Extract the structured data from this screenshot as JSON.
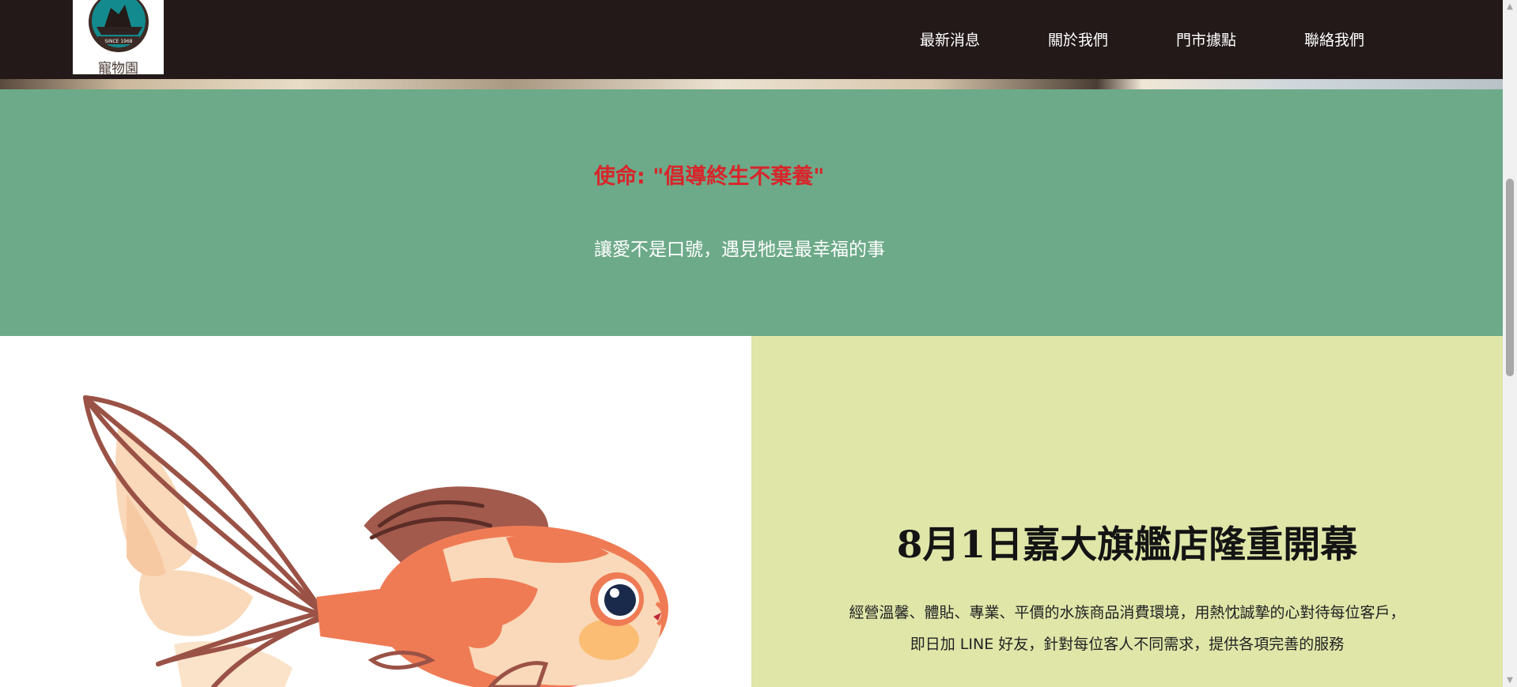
{
  "header": {
    "logo": {
      "name": "寵物園",
      "badge_text": "SINCE 1968"
    },
    "nav": [
      {
        "label": "最新消息"
      },
      {
        "label": "關於我們"
      },
      {
        "label": "門市據點"
      },
      {
        "label": "聯絡我們"
      }
    ]
  },
  "mission": {
    "title": "使命: \"倡導終生不棄養\"",
    "subtitle": "讓愛不是口號，遇見牠是最幸福的事"
  },
  "news": {
    "title": "8月1日嘉大旗艦店隆重開幕",
    "line1": "經營溫馨、體貼、專業、平價的水族商品消費環境，用熱忱誠摯的心對待每位客戶，",
    "line2": "即日加 LINE 好友，針對每位客人不同需求，提供各項完善的服務"
  },
  "colors": {
    "header_bg": "#231919",
    "mission_bg": "#6daa89",
    "mission_title": "#d7262b",
    "news_bg": "#dfe6a8"
  }
}
